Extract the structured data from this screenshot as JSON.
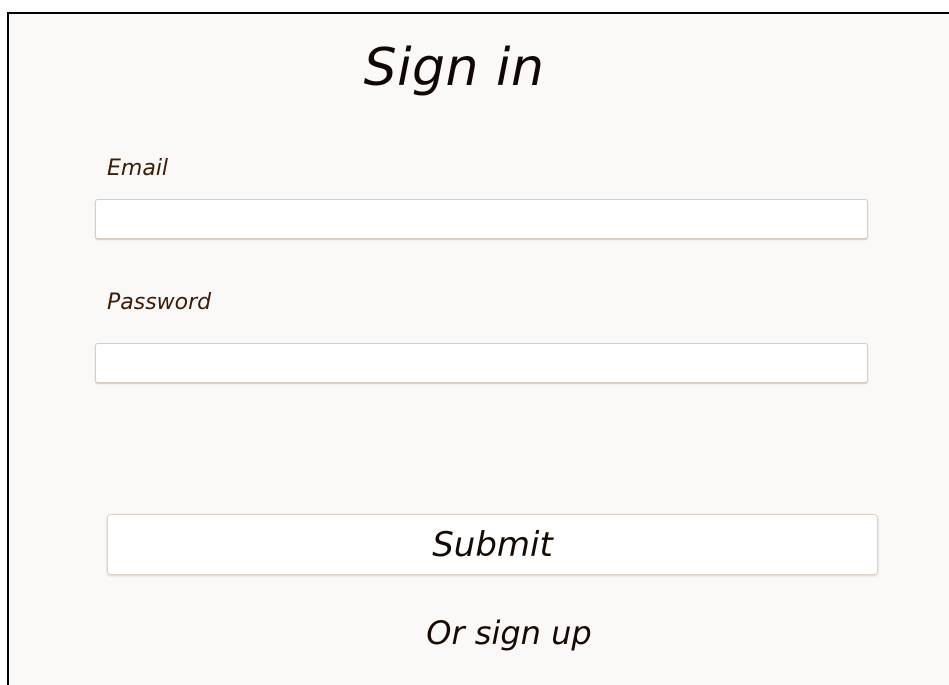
{
  "form": {
    "title": "Sign in",
    "email": {
      "label": "Email",
      "value": "",
      "placeholder": ""
    },
    "password": {
      "label": "Password",
      "value": "",
      "placeholder": ""
    },
    "submit_label": "Submit",
    "signup_link": "Or sign up"
  },
  "colors": {
    "background": "#fbf8f8",
    "text": "#0f0703",
    "label": "#3a1d08",
    "field_border": "#d9ccc3"
  }
}
